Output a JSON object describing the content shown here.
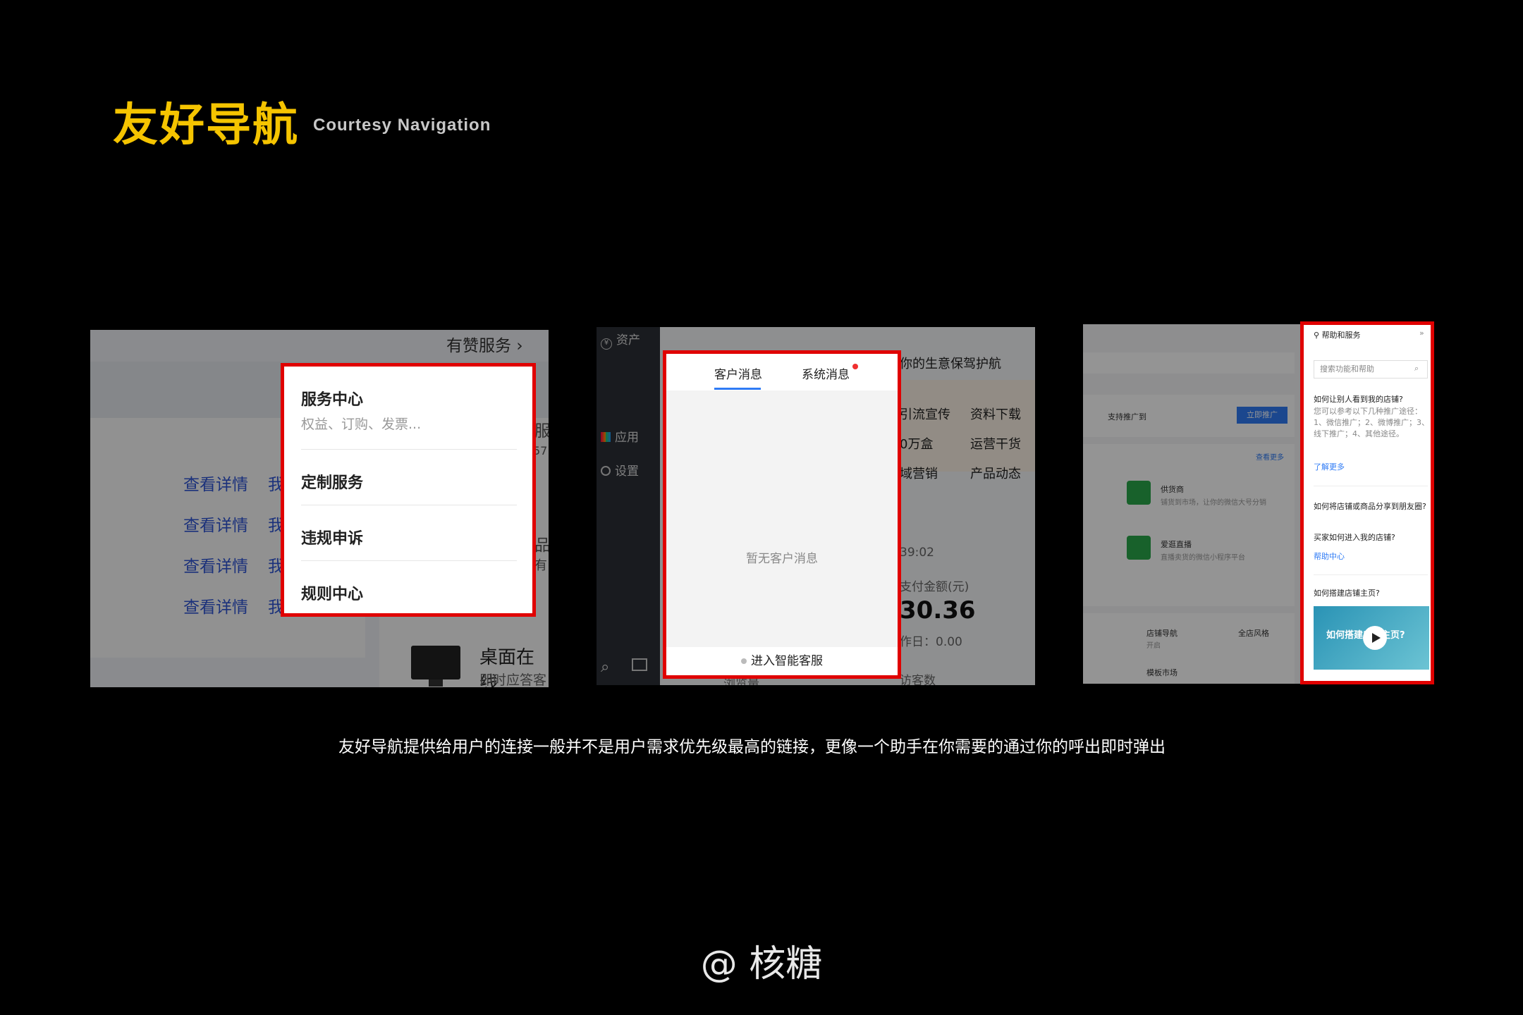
{
  "header": {
    "title": "友好导航",
    "subtitle": "Courtesy Navigation"
  },
  "panel1": {
    "top_link": "有赞服务",
    "links": [
      "查看详情",
      "查看详情",
      "查看详情",
      "查看详情"
    ],
    "link_fragment": "我",
    "right_fragments": [
      "服",
      "57",
      "品",
      "有"
    ],
    "desktop_title": "桌面在线",
    "desktop_sub": "即时应答客",
    "menu": {
      "service_center": "服务中心",
      "service_center_sub": "权益、订购、发票...",
      "custom_service": "定制服务",
      "violation_appeal": "违规申诉",
      "rules_center": "规则中心"
    }
  },
  "panel2": {
    "sidebar": {
      "assets": "资产",
      "apps": "应用",
      "settings": "设置"
    },
    "bg": {
      "banner": "你的生意保驾护航",
      "promo": "引流宣传",
      "download": "资料下载",
      "box": "0万盒",
      "ops": "运营干货",
      "domain_marketing": "域营销",
      "product_news": "产品动态",
      "time": "39:02",
      "pay_label": "支付金额(元)",
      "pay_value": "30.36",
      "yesterday": "作日：0.00",
      "visitors": "访客数",
      "views": "浏览量"
    },
    "chat": {
      "tab_customer": "客户消息",
      "tab_system": "系统消息",
      "empty": "暂无客户消息",
      "footer": "进入智能客服"
    }
  },
  "panel3": {
    "bg": {
      "support": "支持推广到",
      "promote_btn": "立即推广",
      "more": "查看更多",
      "supplier": "供货商",
      "supplier_sub": "铺货到市场，让你的微信大号分销",
      "live": "爱逛直播",
      "live_sub": "直播卖货的微信小程序平台",
      "shop_nav": "店铺导航",
      "shop_nav_status": "开启",
      "shop_style": "全店风格",
      "template_market": "模板市场"
    },
    "help": {
      "title": "帮助和服务",
      "search_placeholder": "搜索功能和帮助",
      "q1": "如何让别人看到我的店铺?",
      "a1": "您可以参考以下几种推广途径：1、微信推广；2、微博推广；3、线下推广；4、其他途径。",
      "more": "了解更多",
      "q2": "如何将店铺或商品分享到朋友圈?",
      "q3": "买家如何进入我的店铺?",
      "help_center": "帮助中心",
      "q4": "如何搭建店铺主页?",
      "video_title": "如何搭建店铺主页?"
    }
  },
  "description": "友好导航提供给用户的连接一般并不是用户需求优先级最高的链接，更像一个助手在你需要的通过你的呼出即时弹出",
  "footer": "@ 核糖",
  "colors": {
    "accent": "#f5c400",
    "highlight": "#e00000",
    "link": "#2f55d4"
  }
}
